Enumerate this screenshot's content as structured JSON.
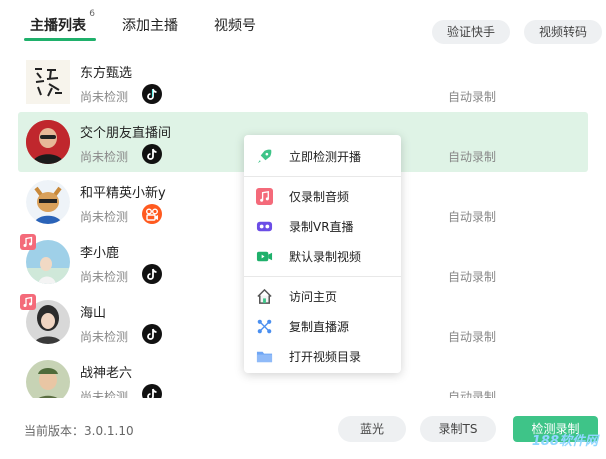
{
  "tabs": [
    {
      "label": "主播列表",
      "count": "6"
    },
    {
      "label": "添加主播"
    },
    {
      "label": "视频号"
    }
  ],
  "header_buttons": {
    "verify": "验证快手",
    "transcode": "视频转码"
  },
  "streamers": [
    {
      "name": "东方甄选",
      "status": "尚未检测",
      "platform": "tiktok-icon",
      "mode": "自动录制"
    },
    {
      "name": "交个朋友直播间",
      "status": "尚未检测",
      "platform": "tiktok-icon",
      "mode": "自动录制"
    },
    {
      "name": "和平精英小新y",
      "status": "尚未检测",
      "platform": "kuaishou-icon",
      "mode": "自动录制"
    },
    {
      "name": "李小鹿",
      "status": "尚未检测",
      "platform": "tiktok-icon",
      "mode": "自动录制"
    },
    {
      "name": "海山",
      "status": "尚未检测",
      "platform": "tiktok-icon",
      "mode": "自动录制"
    },
    {
      "name": "战神老六",
      "status": "尚未检测",
      "platform": "tiktok-icon",
      "mode": "自动录制"
    }
  ],
  "avatar_logo_text": "东方甄选",
  "context_menu": {
    "items": [
      {
        "label": "立即检测开播",
        "icon": "rocket-icon"
      },
      {
        "label": "仅录制音频",
        "icon": "music-icon"
      },
      {
        "label": "录制VR直播",
        "icon": "vr-icon"
      },
      {
        "label": "默认录制视频",
        "icon": "video-icon"
      },
      {
        "label": "访问主页",
        "icon": "home-icon"
      },
      {
        "label": "复制直播源",
        "icon": "link-icon"
      },
      {
        "label": "打开视频目录",
        "icon": "folder-icon"
      }
    ]
  },
  "footer": {
    "version": "当前版本：3.0.1.10",
    "bluray": "蓝光",
    "record_ts": "录制TS",
    "detect_record": "检测录制",
    "watermark": "188软件网"
  },
  "colors": {
    "accent": "#1fb06b",
    "selected_row": "#dff3e6",
    "primary_button": "#3ec488"
  }
}
